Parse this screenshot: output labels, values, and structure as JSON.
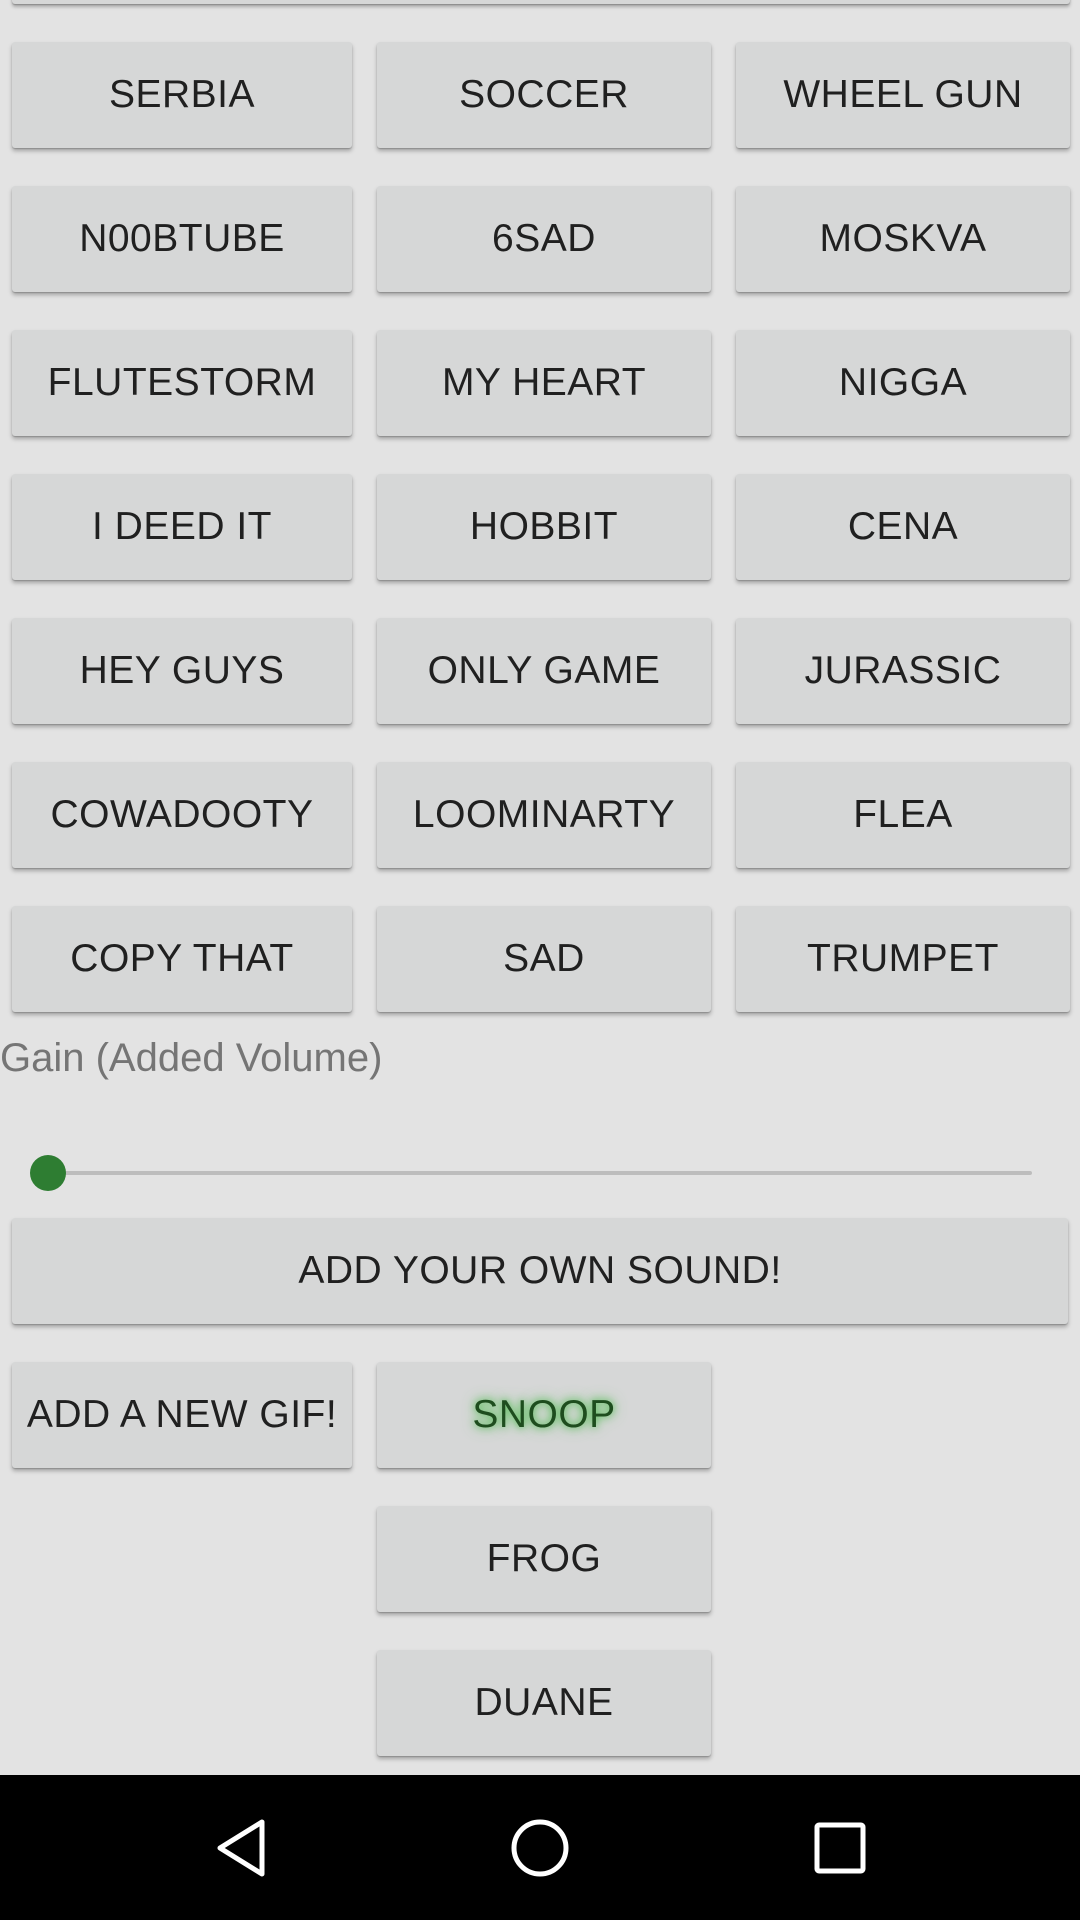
{
  "sound_buttons": [
    [
      "SERBIA",
      "SOCCER",
      "WHEEL GUN"
    ],
    [
      "N00BTUBE",
      "6SAD",
      "MOSKVA"
    ],
    [
      "FLUTESTORM",
      "MY HEART",
      "NIGGA"
    ],
    [
      "I DEED IT",
      "HOBBIT",
      "CENA"
    ],
    [
      "HEY GUYS",
      "ONLY GAME",
      "JURASSIC"
    ],
    [
      "COWADOOTY",
      "LOOMINARTY",
      "FLEA"
    ],
    [
      "COPY THAT",
      "SAD",
      "TRUMPET"
    ]
  ],
  "gain": {
    "label": "Gain (Added Volume)",
    "value": 0,
    "accent_color": "#2e7d32"
  },
  "add_sound_label": "ADD YOUR OWN SOUND!",
  "add_gif_label": "ADD A NEW GIF!",
  "gif_buttons": [
    "SNOOP",
    "FROG",
    "DUANE"
  ],
  "navigation": {
    "back_icon": "back-triangle-icon",
    "home_icon": "home-circle-icon",
    "recents_icon": "recents-square-icon"
  }
}
